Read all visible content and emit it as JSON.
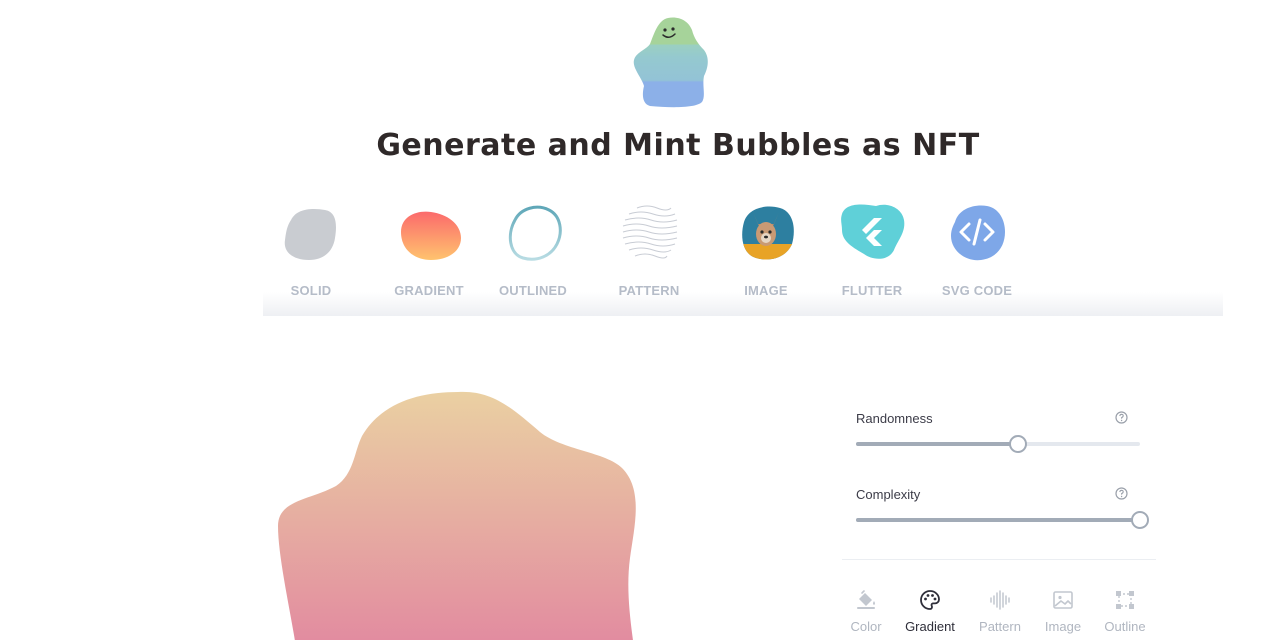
{
  "title": "Generate and Mint Bubbles as NFT",
  "types": [
    {
      "id": "solid",
      "label": "SOLID",
      "icon": "solid-blob-icon"
    },
    {
      "id": "gradient",
      "label": "GRADIENT",
      "icon": "gradient-blob-icon"
    },
    {
      "id": "outlined",
      "label": "OUTLINED",
      "icon": "outlined-blob-icon"
    },
    {
      "id": "pattern",
      "label": "PATTERN",
      "icon": "pattern-blob-icon"
    },
    {
      "id": "image",
      "label": "IMAGE",
      "icon": "dog-photo-blob-icon"
    },
    {
      "id": "flutter",
      "label": "FLUTTER",
      "icon": "flutter-logo-icon"
    },
    {
      "id": "svg",
      "label": "SVG CODE",
      "icon": "code-icon"
    }
  ],
  "controls": {
    "randomness": {
      "label": "Randomness",
      "value": 0.57
    },
    "complexity": {
      "label": "Complexity",
      "value": 1.0
    }
  },
  "tabs": [
    {
      "label": "Color",
      "icon": "paint-bucket-icon",
      "active": false
    },
    {
      "label": "Gradient",
      "icon": "palette-icon",
      "active": true
    },
    {
      "label": "Pattern",
      "icon": "sound-wave-icon",
      "active": false
    },
    {
      "label": "Image",
      "icon": "image-icon",
      "active": false
    },
    {
      "label": "Outline",
      "icon": "outline-frame-icon",
      "active": false
    }
  ],
  "colors": {
    "bubble_gradient_top": "#ead0a2",
    "bubble_gradient_bottom": "#e28aa0",
    "solid": "#c9ccd1",
    "flutter": "#5fd0d8",
    "svg_code": "#7ea7e8"
  }
}
